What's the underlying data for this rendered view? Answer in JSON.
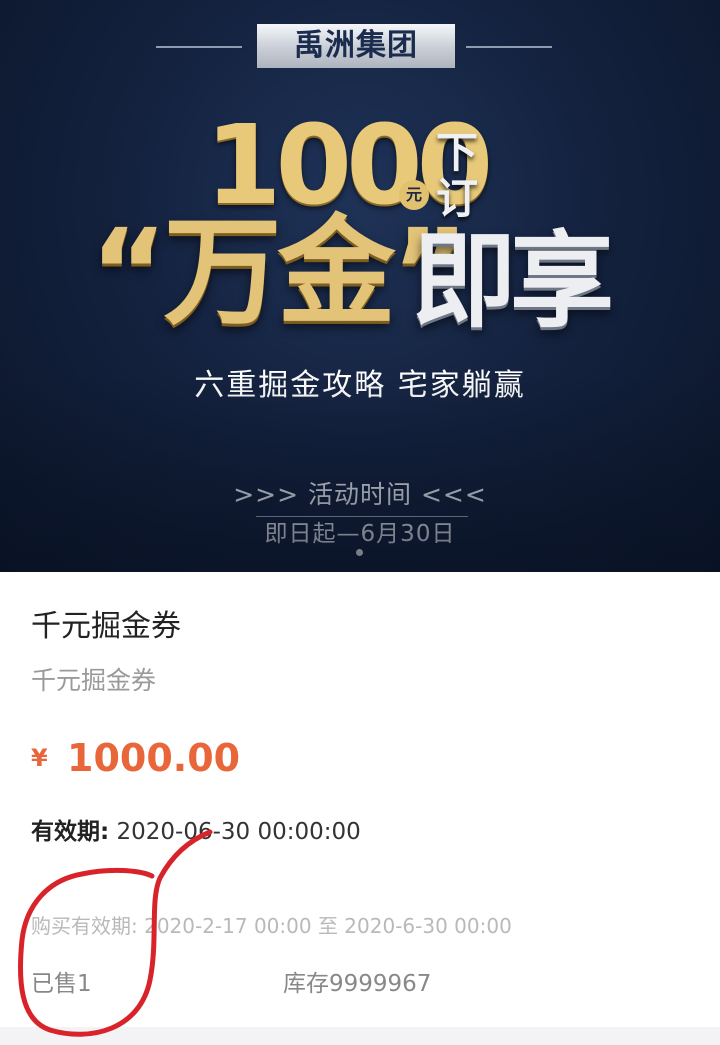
{
  "banner": {
    "brand": "禹洲集团",
    "amount": "1000",
    "amount_unit": "元",
    "order_text": "下订",
    "headline_gold": "“万金”",
    "headline_silver": "即享",
    "slogan": "六重掘金攻略 宅家躺赢",
    "activity_label": ">>> 活动时间 <<<",
    "activity_period": "即日起—6月30日"
  },
  "product": {
    "title": "千元掘金券",
    "subtitle": "千元掘金券",
    "currency": "¥",
    "price": "1000.00",
    "validity_label": "有效期:",
    "validity_value": "2020-06-30 00:00:00",
    "purchase_period": "购买有效期: 2020-2-17 00:00 至 2020-6-30 00:00",
    "sold": "已售1",
    "stock": "库存9999967"
  },
  "colors": {
    "banner_bg": "#14223f",
    "gold": "#e2c377",
    "price": "#e8663a",
    "annotation": "#d8232a"
  }
}
